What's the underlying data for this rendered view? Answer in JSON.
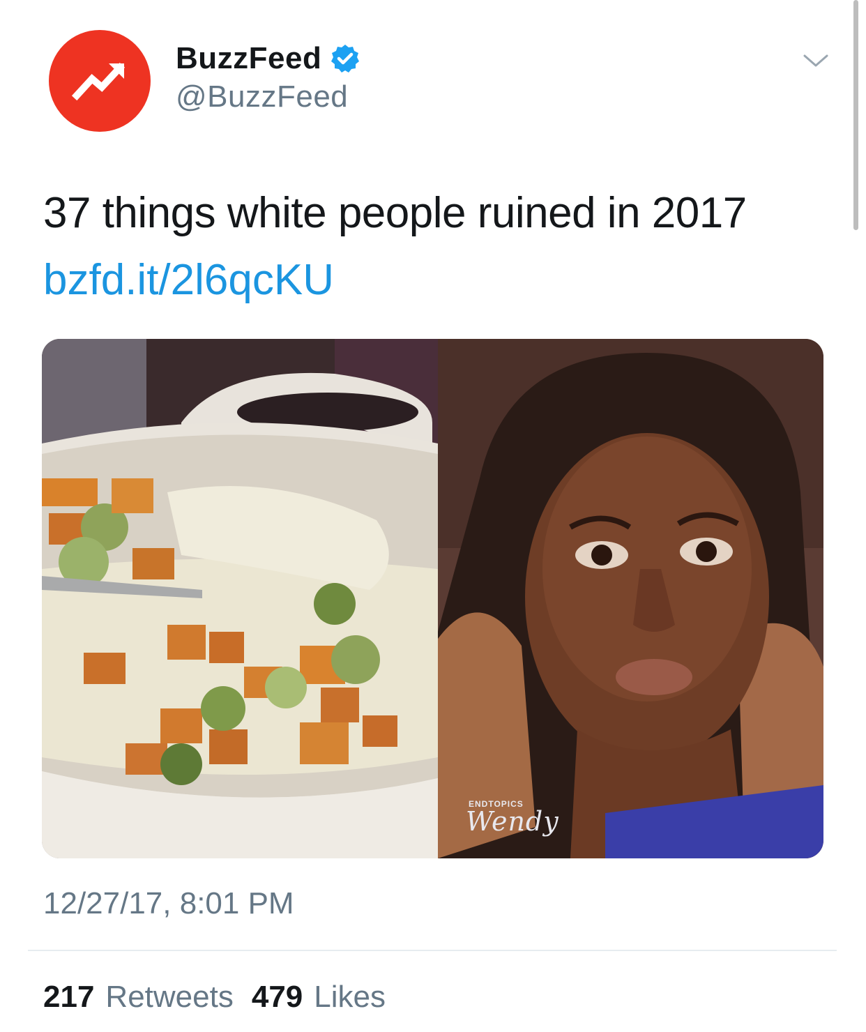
{
  "account": {
    "display_name": "BuzzFeed",
    "handle": "@BuzzFeed",
    "brand_color": "#ee3322",
    "avatar_icon": "trending-arrow-icon",
    "verified_color": "#1da1f2"
  },
  "tweet": {
    "text": "37 things white people ruined in 2017",
    "link": "bzfd.it/2l6qcKU",
    "link_color": "#1b95e0",
    "timestamp": "12/27/17, 8:01 PM"
  },
  "media": {
    "watermark": "Wendy",
    "watermark_small": "ENDTOPICS"
  },
  "stats": {
    "retweets_count": "217",
    "retweets_label": "Retweets",
    "likes_count": "479",
    "likes_label": "Likes"
  }
}
